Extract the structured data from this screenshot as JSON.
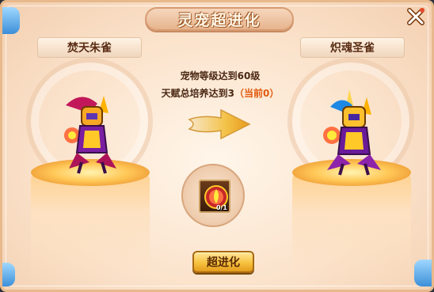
{
  "title": "灵宠超进化",
  "pets": {
    "from": {
      "name": "焚天朱雀"
    },
    "to": {
      "name": "炽魂圣雀"
    }
  },
  "requirements": {
    "line1": "宠物等级达到60级",
    "line2_prefix": "天赋总培养达到3",
    "line2_current": "（当前0）"
  },
  "item": {
    "count": "0/1"
  },
  "evolve_button": "超进化"
}
